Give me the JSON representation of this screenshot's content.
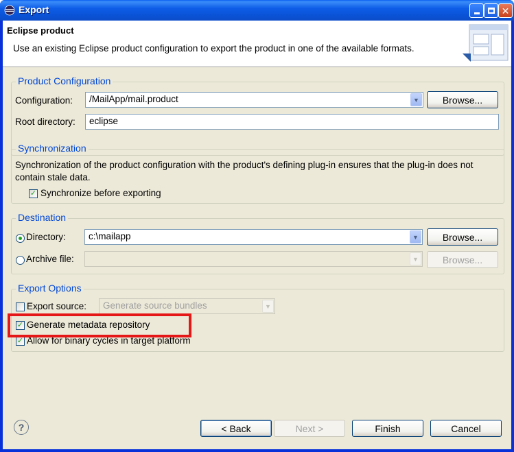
{
  "window": {
    "title": "Export"
  },
  "banner": {
    "title": "Eclipse product",
    "description": "Use an existing Eclipse product configuration to export the product in one of the available formats."
  },
  "product_configuration": {
    "group_label": "Product Configuration",
    "configuration_label": "Configuration:",
    "configuration_value": "/MailApp/mail.product",
    "browse_label": "Browse...",
    "root_directory_label": "Root directory:",
    "root_directory_value": "eclipse"
  },
  "synchronization": {
    "group_label": "Synchronization",
    "description": "Synchronization of the product configuration with the product's defining plug-in ensures that the plug-in does not contain stale data.",
    "sync_label": "Synchronize before exporting",
    "sync_checked": true
  },
  "destination": {
    "group_label": "Destination",
    "directory_label": "Directory:",
    "directory_value": "c:\\mailapp",
    "directory_browse_label": "Browse...",
    "archive_label": "Archive file:",
    "archive_value": "",
    "archive_browse_label": "Browse...",
    "selected": "directory"
  },
  "export_options": {
    "group_label": "Export Options",
    "export_source_label": "Export source:",
    "export_source_checked": false,
    "export_source_value": "Generate source bundles",
    "metadata_label": "Generate metadata repository",
    "metadata_checked": true,
    "binary_cycles_label": "Allow for binary cycles in target platform",
    "binary_cycles_checked": true
  },
  "footer": {
    "back_label": "< Back",
    "next_label": "Next >",
    "finish_label": "Finish",
    "cancel_label": "Cancel"
  },
  "colors": {
    "group_label": "#0046d5",
    "highlight": "#e51717"
  }
}
